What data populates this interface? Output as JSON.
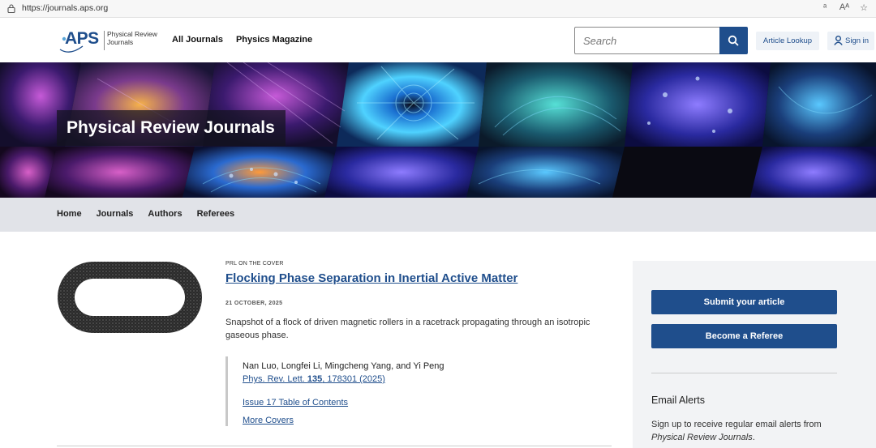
{
  "browser": {
    "url": "https://journals.aps.org",
    "icons": [
      "read-aloud-icon",
      "text-size-icon",
      "favorite-star-icon"
    ]
  },
  "header": {
    "logo_text": "APS",
    "logo_sub_line1": "Physical Review",
    "logo_sub_line2": "Journals",
    "nav": [
      "All Journals",
      "Physics Magazine"
    ],
    "search_placeholder": "Search",
    "article_lookup": "Article Lookup",
    "sign_in": "Sign in"
  },
  "banner": {
    "title": "Physical Review Journals"
  },
  "sub_nav": [
    "Home",
    "Journals",
    "Authors",
    "Referees"
  ],
  "article": {
    "kicker": "PRL ON THE COVER",
    "title": "Flocking Phase Separation in Inertial Active Matter",
    "date": "21 OCTOBER, 2025",
    "description": "Snapshot of a flock of driven magnetic rollers in a racetrack propagating through an isotropic gaseous phase.",
    "authors": "Nan Luo, Longfei Li, Mingcheng Yang, and Yi Peng",
    "citation_prefix": "Phys. Rev. Lett. ",
    "citation_volume": "135",
    "citation_suffix": ", 178301 (2025)",
    "toc_link": "Issue 17 Table of Contents",
    "more_covers": "More Covers"
  },
  "sidebar": {
    "submit": "Submit your article",
    "referee": "Become a Referee",
    "alerts_title": "Email Alerts",
    "alerts_desc_prefix": "Sign up to receive regular email alerts from ",
    "alerts_desc_italic": "Physical Review Journals",
    "alerts_desc_suffix": "."
  },
  "colors": {
    "brand": "#1f4e8c",
    "subnav_bg": "#e1e3e8",
    "sidebar_bg": "#f2f3f5"
  }
}
